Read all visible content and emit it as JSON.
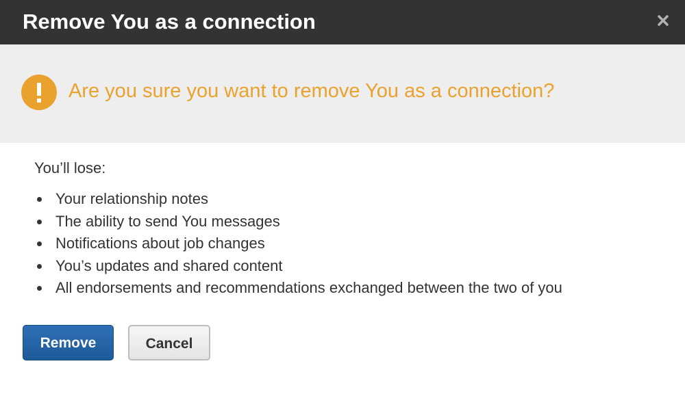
{
  "dialog": {
    "title": "Remove You as a connection",
    "close_icon": "close-icon"
  },
  "warning": {
    "icon": "exclamation-icon",
    "icon_color": "#eaa22e",
    "message": "Are you sure you want to remove You as a connection?"
  },
  "body": {
    "lose_label": "You’ll lose:",
    "items": [
      "Your relationship notes",
      "The ability to send You messages",
      "Notifications about job changes",
      "You’s updates and shared content",
      "All endorsements and recommendations exchanged between the two of you"
    ]
  },
  "buttons": {
    "remove_label": "Remove",
    "cancel_label": "Cancel",
    "primary_color": "#1d5a98"
  }
}
